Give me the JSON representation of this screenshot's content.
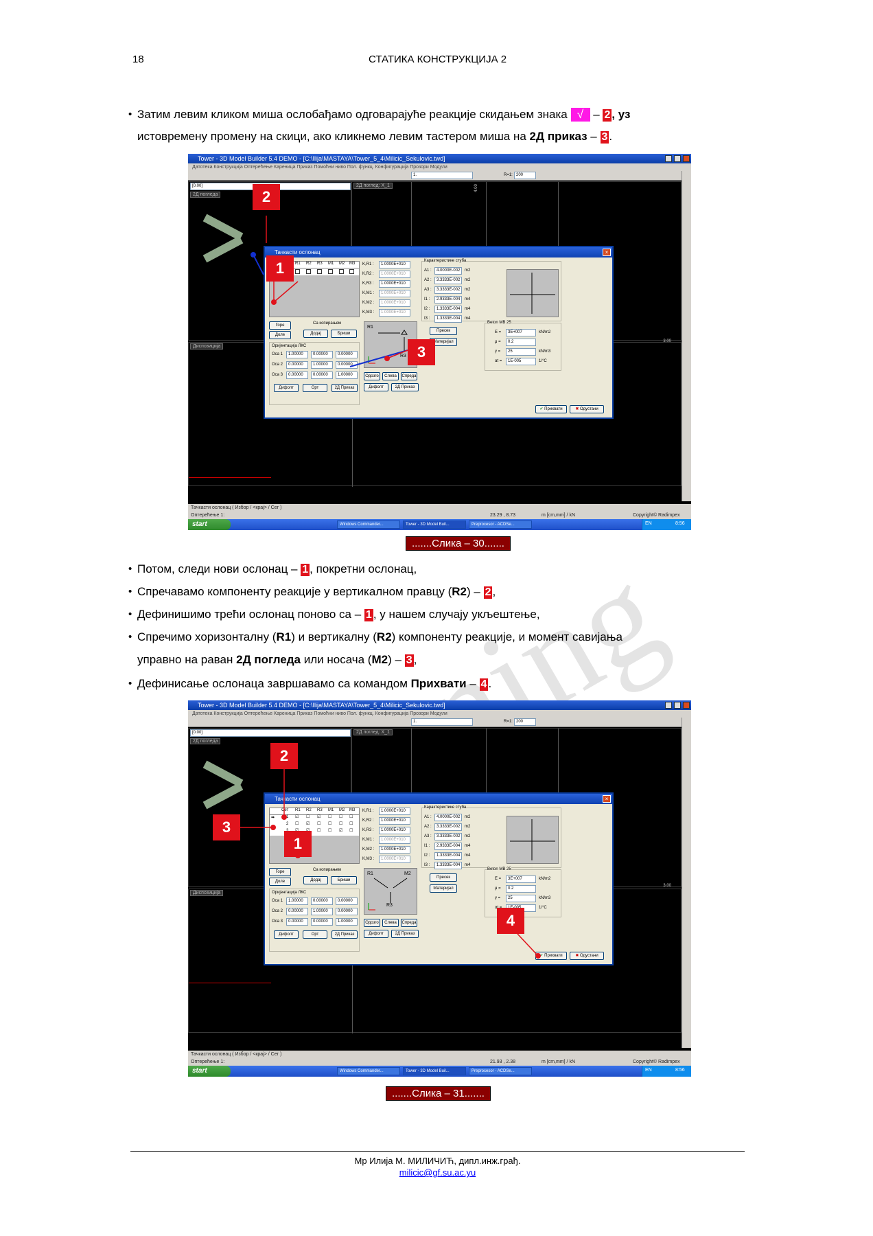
{
  "header": {
    "page_number": "18",
    "title": "СТАТИКА КОНСТРУКЦИЈА 2"
  },
  "watermark": "elearning",
  "intro": {
    "part1": "Затим левим кликом миша ослобађамо одговарајуће реакције скидањем знака",
    "check_symbol": "√",
    "dash1": "–",
    "badge1": "2",
    "part2": ", уз",
    "line2_text": "истовремену промену на скици, ако кликнемо левим тастером миша на",
    "line2_bold": "2Д приказ",
    "dash2": "–",
    "badge2": "3",
    "end": "."
  },
  "figure1": {
    "caption": ".......Слика – 30.......",
    "window_title": "Tower - 3D Model Builder 5.4 DEMO - [C:\\Ilija\\MASTAYA\\Tower_5_4\\Milicic_Sekulovic.twd]",
    "menu": "Датотека  Конструкција  Оптерећење  Кареница  Приказ  Помоћни ниво  Пол. функц.  Конфигурација  Прозори  Модули",
    "level": "[0.00]",
    "view_2d": "2Д погледа",
    "view_dispos": "Диспозиција",
    "dropdown_label": "2Д поглед: X_1",
    "zoom_label": "R=1:",
    "zoom_value": "200",
    "level_input": "1.",
    "dialog_title": "Тачкасти ослонац",
    "table_headers": [
      "Сет",
      "R1",
      "R2",
      "R3",
      "M1",
      "M2",
      "M3"
    ],
    "rows": [
      "1"
    ],
    "k_labels": [
      "K,R1 :",
      "K,R2 :",
      "K,R3 :",
      "K,M1 :",
      "K,M2 :",
      "K,M3 :"
    ],
    "k_values": [
      "1.0000E+010",
      "1.0000E+010",
      "1.0000E+010",
      "1.0000E+010",
      "1.0000E+010",
      "1.0000E+010"
    ],
    "char_title": "Карактеристике стуба",
    "char_labels": [
      "A1 :",
      "A2 :",
      "A3 :",
      "I1 :",
      "I2 :",
      "I3 :"
    ],
    "char_values": [
      "4.0000E-002",
      "3.3333E-002",
      "3.3333E-002",
      "2.9333E-004",
      "1.3333E-004",
      "1.3333E-004"
    ],
    "char_units": [
      "m2",
      "m2",
      "m2",
      "m4",
      "m4",
      "m4"
    ],
    "beton_title": "Beton MB 25",
    "beton_labels": [
      "E =",
      "μ =",
      "γ =",
      "αt ="
    ],
    "beton_values": [
      "3E+007",
      "0.2",
      "25",
      "1E-005"
    ],
    "beton_units": [
      "kN/m2",
      "",
      "kN/m3",
      "1/°C"
    ],
    "btn_gore": "Горе",
    "btn_dole": "Доле",
    "chk_copy": "Са копирањем",
    "btn_add": "Додај",
    "btn_delete": "Бриши",
    "orient_title": "Оријентација ЛКС",
    "orient_rows": [
      {
        "label": "Оса 1",
        "vals": [
          "1.00000",
          "0.00000",
          "0.00000"
        ]
      },
      {
        "label": "Оса 2",
        "vals": [
          "0.00000",
          "1.00000",
          "0.00000"
        ]
      },
      {
        "label": "Оса 3",
        "vals": [
          "0.00000",
          "0.00000",
          "1.00000"
        ]
      }
    ],
    "btn_default": "Дифолт",
    "btn_ort": "Орт",
    "btn_2d": "2Д Приказ",
    "btn_odozgo": "Одозго",
    "btn_sleva": "Слева",
    "btn_spreda": "Спреда",
    "btn_default2": "Дифолт",
    "btn_2d_prikaz": "2Д Приказ",
    "btn_presek": "Пресек",
    "btn_material": "Материјал",
    "btn_accept": "Прихвати",
    "btn_cancel": "Одустани",
    "sketch_r1": "R1",
    "sketch_r3": "R3",
    "status1": "Тачкасти ослонац ( Избор / <крај> / Сег )",
    "status2": "Оптерећење 1:",
    "coords": "23.29 , 8.73",
    "units": "m [cm,mm] / kN",
    "copyright": "Copyright© Radimpex",
    "start": "start",
    "tasks": [
      "Windows Commander...",
      "Tower - 3D Model Buil...",
      "Preprocesor - ACDSe..."
    ],
    "clock": "8:56",
    "lang": "EN",
    "axis_label": "4.00",
    "axis_right": "3.00",
    "callouts": [
      "1",
      "2",
      "3"
    ]
  },
  "bullets": [
    {
      "text": "Потом, следи нови ослонац –",
      "badge": "1",
      "tail": ", покретни ослонац,"
    },
    {
      "text": "Спречавамо компоненту реакције у вертикалном правцу (",
      "bold": "R2",
      "text2": ") –",
      "badge": "2",
      "tail": ","
    },
    {
      "text": "Дефинишимо трећи ослонац поново са –",
      "badge": "1",
      "tail": ", у нашем случају укљештење,"
    },
    {
      "text": "Спречимо хоризонталну (",
      "b1": "R1",
      "t2": ") и вертикалну (",
      "b2": "R2",
      "t3": ") компоненту реакције, и момент савијања",
      "line2a": "управно на раван",
      "line2b": "2Д погледа",
      "line2c": "или носача (",
      "line2d": "M2",
      "line2e": ") –",
      "badge": "3",
      "tail": ","
    },
    {
      "text": "Дефинисање ослонаца завршавамо са командом",
      "bold": "Прихвати",
      "text2": "–",
      "badge": "4",
      "tail": "."
    }
  ],
  "figure2": {
    "caption": ".......Слика – 31.......",
    "rows": [
      "1",
      "2",
      "3"
    ],
    "sketch_m2": "M2",
    "coords": "21.93 , 2.38",
    "callouts": [
      "1",
      "2",
      "3",
      "4"
    ]
  },
  "footer": {
    "author": "Мр Илија М. МИЛИЧИЋ, дипл.инж.грађ.",
    "email": "milicic@gf.su.ac.yu"
  }
}
